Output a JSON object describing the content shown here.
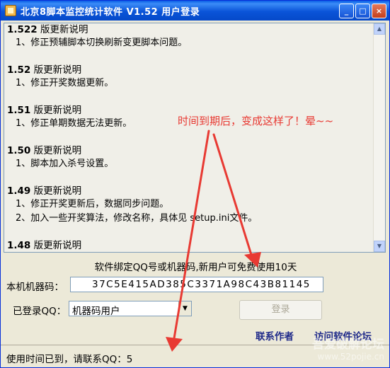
{
  "window": {
    "title": "北京8脚本监控统计软件 V1.52 用户登录",
    "buttons": {
      "minimize": "_",
      "maximize": "□",
      "close": "×"
    }
  },
  "release_notes": [
    {
      "version": "1.522",
      "suffix": " 版更新说明",
      "items": [
        "1、修正预辅脚本切换刷新变更脚本问题。"
      ]
    },
    {
      "version": "1.52",
      "suffix": " 版更新说明",
      "items": [
        "1、修正开奖数据更新。"
      ]
    },
    {
      "version": "1.51",
      "suffix": " 版更新说明",
      "items": [
        "1、修正单期数据无法更新。"
      ]
    },
    {
      "version": "1.50",
      "suffix": " 版更新说明",
      "items": [
        "1、脚本加入杀号设置。"
      ]
    },
    {
      "version": "1.49",
      "suffix": " 版更新说明",
      "items": [
        "1、修正开奖更新后，数据同步问题。",
        "2、加入一些开奖算法，修改名称，具体见 setup.ini文件。"
      ]
    },
    {
      "version": "1.48",
      "suffix": " 版更新说明",
      "items": []
    }
  ],
  "bind_message": "软件绑定QQ号或机器码,新用户可免费使用10天",
  "machine_code": {
    "label": "本机机器码：",
    "value": "37C5E415AD385C3371A98C43B81145"
  },
  "qq": {
    "label": "已登录QQ：",
    "selected": "机器码用户"
  },
  "login_button": "登录",
  "links": {
    "contact": "联系作者",
    "forum": "访问软件论坛"
  },
  "status": {
    "text": "使用时间已到，请联系QQ：5"
  },
  "annotation": {
    "text": "时间到期后，变成这样了！晕~~",
    "color": "#e83a33"
  },
  "watermark": {
    "line1": "吾爱破解论坛",
    "line2": "www.52pojie.cn"
  }
}
